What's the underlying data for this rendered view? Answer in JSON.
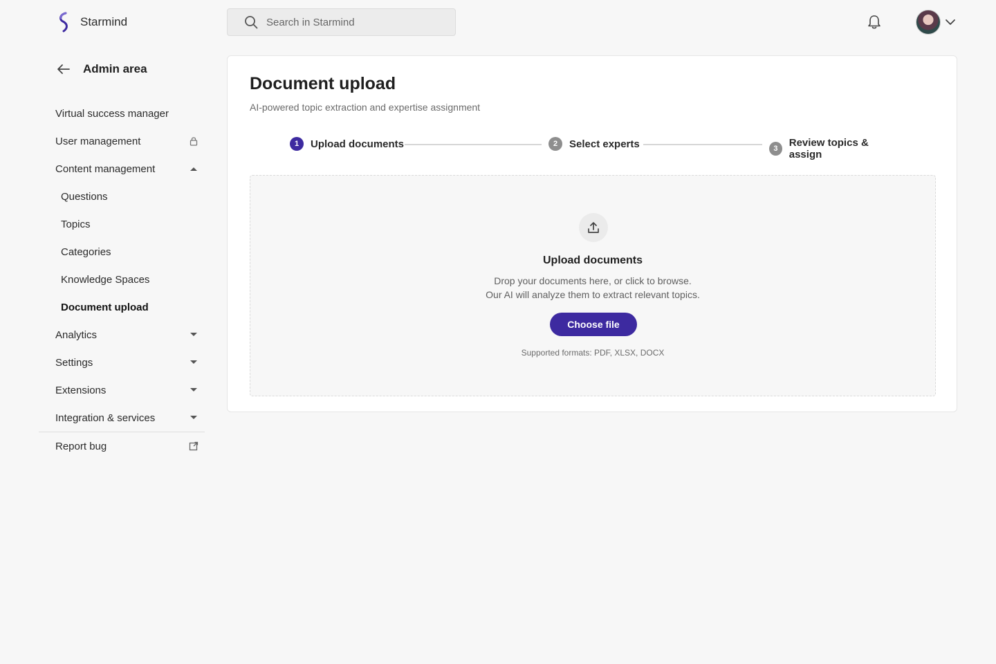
{
  "app": {
    "name": "Starmind"
  },
  "search": {
    "placeholder": "Search in Starmind"
  },
  "sidebar": {
    "header": "Admin area",
    "items": [
      {
        "label": "Virtual success manager"
      },
      {
        "label": "User management"
      },
      {
        "label": "Content management"
      },
      {
        "label": "Questions"
      },
      {
        "label": "Topics"
      },
      {
        "label": "Categories"
      },
      {
        "label": "Knowledge Spaces"
      },
      {
        "label": "Document upload"
      },
      {
        "label": "Analytics"
      },
      {
        "label": "Settings"
      },
      {
        "label": "Extensions"
      },
      {
        "label": "Integration & services"
      },
      {
        "label": "Report bug"
      }
    ]
  },
  "main": {
    "title": "Document upload",
    "subtitle": "AI-powered topic extraction and expertise assignment",
    "steps": [
      {
        "num": "1",
        "label": "Upload documents"
      },
      {
        "num": "2",
        "label": "Select experts"
      },
      {
        "num": "3",
        "label": "Review topics & assign"
      }
    ],
    "dropzone": {
      "title": "Upload documents",
      "line1": "Drop your documents here, or click to browse.",
      "line2": "Our AI will analyze them to extract relevant topics.",
      "button": "Choose file",
      "formats": "Supported formats: PDF, XLSX, DOCX"
    }
  },
  "colors": {
    "accent": "#3d2aa0",
    "inactive_step": "#8e8e8e",
    "background": "#f7f7f7"
  },
  "icons": [
    "starmind-logo-icon",
    "search-icon",
    "bell-icon",
    "chevron-down-icon",
    "arrow-left-icon",
    "lock-icon",
    "caret-up-icon",
    "caret-down-icon",
    "external-link-icon",
    "upload-icon"
  ]
}
